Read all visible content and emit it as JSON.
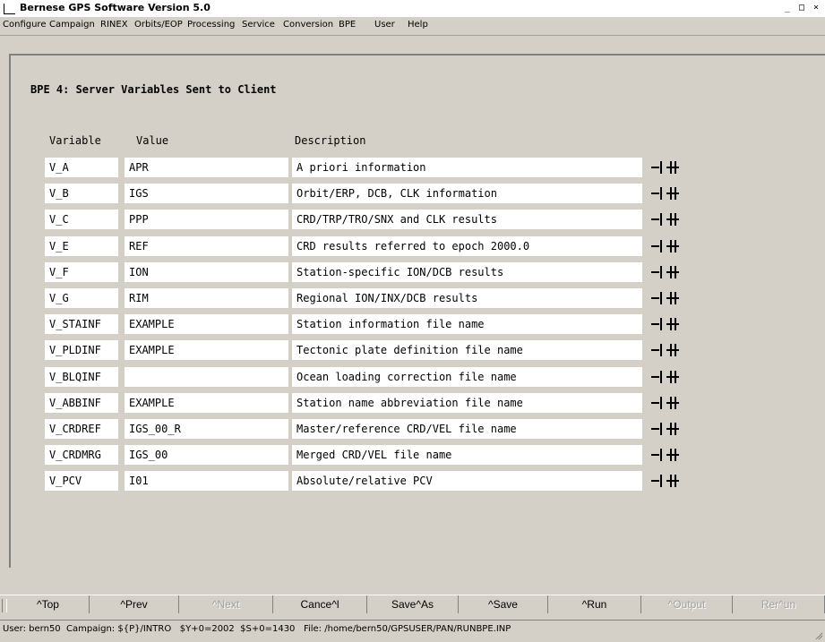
{
  "window": {
    "title": "Bernese GPS Software Version 5.0",
    "controls": [
      "_",
      "□",
      "×"
    ]
  },
  "menu": [
    "Configure",
    "Campaign",
    "RINEX",
    "Orbits/EOP",
    "Processing",
    "Service",
    "Conversion",
    "BPE",
    "User",
    "Help"
  ],
  "page": {
    "title": "BPE 4: Server Variables Sent to Client"
  },
  "columns": {
    "variable": "Variable",
    "value": "Value",
    "description": "Description"
  },
  "rows": [
    {
      "variable": "V_A",
      "value": "APR",
      "description": "A priori information"
    },
    {
      "variable": "V_B",
      "value": "IGS",
      "description": "Orbit/ERP, DCB, CLK information"
    },
    {
      "variable": "V_C",
      "value": "PPP",
      "description": "CRD/TRP/TRO/SNX and CLK results"
    },
    {
      "variable": "V_E",
      "value": "REF",
      "description": "CRD results referred to epoch 2000.0"
    },
    {
      "variable": "V_F",
      "value": "ION",
      "description": "Station-specific ION/DCB results"
    },
    {
      "variable": "V_G",
      "value": "RIM",
      "description": "Regional ION/INX/DCB results"
    },
    {
      "variable": "V_STAINF",
      "value": "EXAMPLE",
      "description": "Station information file name"
    },
    {
      "variable": "V_PLDINF",
      "value": "EXAMPLE",
      "description": "Tectonic plate definition file name"
    },
    {
      "variable": "V_BLQINF",
      "value": "",
      "description": "Ocean loading correction file name"
    },
    {
      "variable": "V_ABBINF",
      "value": "EXAMPLE",
      "description": "Station name abbreviation file name"
    },
    {
      "variable": "V_CRDREF",
      "value": "IGS_00_R",
      "description": "Master/reference CRD/VEL file name"
    },
    {
      "variable": "V_CRDMRG",
      "value": "IGS_00",
      "description": "Merged CRD/VEL file name"
    },
    {
      "variable": "V_PCV",
      "value": "I01",
      "description": "Absolute/relative PCV"
    }
  ],
  "buttons": [
    {
      "label": "^Top",
      "enabled": true
    },
    {
      "label": "^Prev",
      "enabled": true
    },
    {
      "label": "^Next",
      "enabled": false
    },
    {
      "label": "Cance^l",
      "enabled": true
    },
    {
      "label": "Save^As",
      "enabled": true
    },
    {
      "label": "^Save",
      "enabled": true
    },
    {
      "label": "^Run",
      "enabled": true
    },
    {
      "label": "^Output",
      "enabled": false
    },
    {
      "label": "Rer^un",
      "enabled": false
    }
  ],
  "status": "User: bern50  Campaign: ${P}/INTRO   $Y+0=2002  $S+0=1430   File: /home/bern50/GPSUSER/PAN/RUNBPE.INP"
}
